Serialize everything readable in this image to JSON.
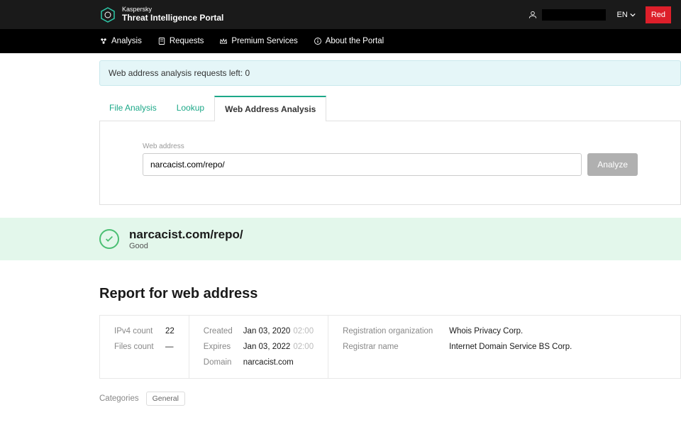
{
  "brand": {
    "small": "Kaspersky",
    "big": "Threat Intelligence Portal"
  },
  "lang": "EN",
  "btn_red": "Red",
  "nav": {
    "analysis": "Analysis",
    "requests": "Requests",
    "premium": "Premium Services",
    "about": "About the Portal"
  },
  "notice": "Web address analysis requests left: 0",
  "tabs": {
    "file": "File Analysis",
    "lookup": "Lookup",
    "web": "Web Address Analysis"
  },
  "search": {
    "label": "Web address",
    "value": "narcacist.com/repo/",
    "analyze_btn": "Analyze"
  },
  "verdict": {
    "url": "narcacist.com/repo/",
    "status": "Good"
  },
  "report": {
    "heading": "Report for web address",
    "ipv4_label": "IPv4 count",
    "ipv4_value": "22",
    "files_label": "Files count",
    "files_value": "—",
    "created_label": "Created",
    "created_date": "Jan 03, 2020",
    "created_time": "02:00",
    "expires_label": "Expires",
    "expires_date": "Jan 03, 2022",
    "expires_time": "02:00",
    "domain_label": "Domain",
    "domain_value": "narcacist.com",
    "regorg_label": "Registration organization",
    "regorg_value": "Whois Privacy Corp.",
    "registrar_label": "Registrar name",
    "registrar_value": "Internet Domain Service BS Corp."
  },
  "categories": {
    "label": "Categories",
    "items": [
      "General"
    ]
  }
}
